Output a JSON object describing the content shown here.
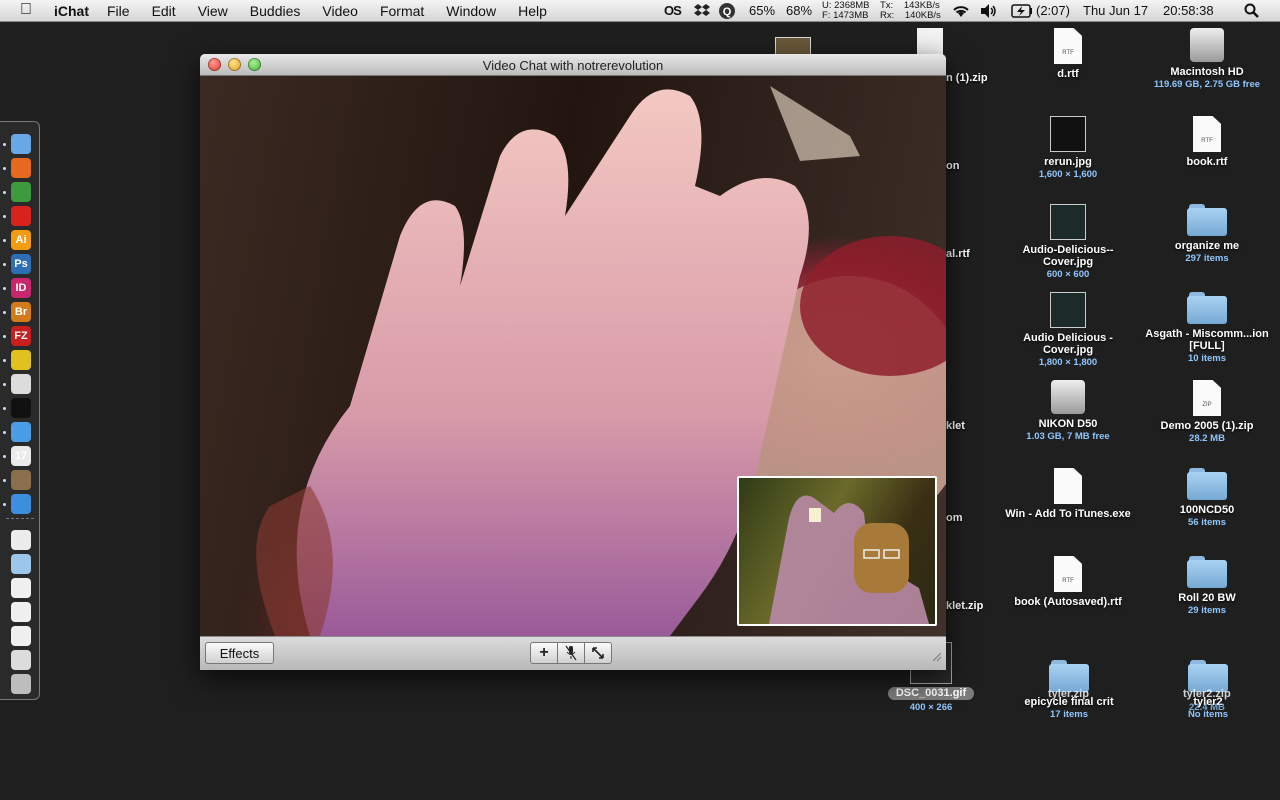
{
  "menubar": {
    "app_name": "iChat",
    "menus": [
      "File",
      "Edit",
      "View",
      "Buddies",
      "Video",
      "Format",
      "Window",
      "Help"
    ],
    "status": {
      "os_label": "OS",
      "cpu_percent": "65%",
      "memory_percent": "68%",
      "mem_used": "U: 2368MB",
      "mem_free": "F: 1473MB",
      "net_tx": "Tx:",
      "net_tx_val": "143KB/s",
      "net_rx": "Rx:",
      "net_rx_val": "140KB/s",
      "battery": "(2:07)",
      "date": "Thu Jun 17",
      "time": "20:58:38"
    }
  },
  "window": {
    "title": "Video Chat with notrerevolution",
    "effects_label": "Effects"
  },
  "desktop": {
    "icons": [
      {
        "label": "d.rtf",
        "sub": "",
        "type": "doc",
        "tag": "RTF"
      },
      {
        "label": "Macintosh HD",
        "sub": "119.69 GB, 2.75 GB free",
        "type": "hd",
        "tag": ""
      },
      {
        "label": "rerun.jpg",
        "sub": "1,600 × 1,600",
        "type": "thumb",
        "tag": ""
      },
      {
        "label": "book.rtf",
        "sub": "",
        "type": "doc",
        "tag": "RTF"
      },
      {
        "label": "Audio-Delicious--Cover.jpg",
        "sub": "600 × 600",
        "type": "thumb",
        "tag": ""
      },
      {
        "label": "organize me",
        "sub": "297 items",
        "type": "folder",
        "tag": ""
      },
      {
        "label": "Audio Delicious - Cover.jpg",
        "sub": "1,800 × 1,800",
        "type": "thumb",
        "tag": ""
      },
      {
        "label": "Asgath - Miscomm...ion [FULL]",
        "sub": "10 items",
        "type": "folder",
        "tag": ""
      },
      {
        "label": "NIKON D50",
        "sub": "1.03 GB, 7 MB free",
        "type": "hd",
        "tag": ""
      },
      {
        "label": "Demo 2005 (1).zip",
        "sub": "28.2 MB",
        "type": "doc",
        "tag": "ZIP"
      },
      {
        "label": "Win - Add To iTunes.exe",
        "sub": "",
        "type": "doc",
        "tag": ""
      },
      {
        "label": "100NCD50",
        "sub": "56 items",
        "type": "folder",
        "tag": ""
      },
      {
        "label": "book (Autosaved).rtf",
        "sub": "",
        "type": "doc",
        "tag": "RTF"
      },
      {
        "label": "Roll 20 BW",
        "sub": "29 items",
        "type": "folder",
        "tag": ""
      },
      {
        "label": "epicycle final crit",
        "sub": "17 items",
        "type": "folder",
        "tag": ""
      },
      {
        "label": "tyler2",
        "sub": "No items",
        "type": "folder",
        "tag": ""
      }
    ],
    "partial_labels": [
      "n (1).zip",
      "on",
      "al.rtf",
      "klet",
      "om",
      "klet.zip"
    ],
    "behind_labels": [
      "tyler.zip",
      "tyler2.zip",
      "22.4 MB"
    ],
    "dsc": {
      "label": "DSC_0031.gif",
      "sub": "400 × 266"
    }
  },
  "dock": {
    "items": [
      "finder-icon",
      "firefox-icon",
      "chrome-icon",
      "acrobat-icon",
      "illustrator-icon",
      "photoshop-icon",
      "indesign-icon",
      "bridge-icon",
      "filezilla-icon",
      "cyberduck-icon",
      "textedit-icon",
      "ableton-live-icon",
      "itunes-icon",
      "ical-icon",
      "address-book-icon",
      "ichat-icon"
    ],
    "labels": [
      "",
      "",
      "",
      "",
      "Ai",
      "Ps",
      "ID",
      "Br",
      "FZ",
      "",
      "",
      "",
      "",
      "17",
      "",
      ""
    ],
    "colors": [
      "#6aa7e8",
      "#e56a1e",
      "#3d9b3d",
      "#d9221e",
      "#f39c12",
      "#2d6fb5",
      "#c8266d",
      "#d27b1a",
      "#c81e1e",
      "#e0c21e",
      "#dcdcdc",
      "#111111",
      "#4a9ee8",
      "#eaeaea",
      "#8a6f4a",
      "#3c8fe0"
    ]
  }
}
